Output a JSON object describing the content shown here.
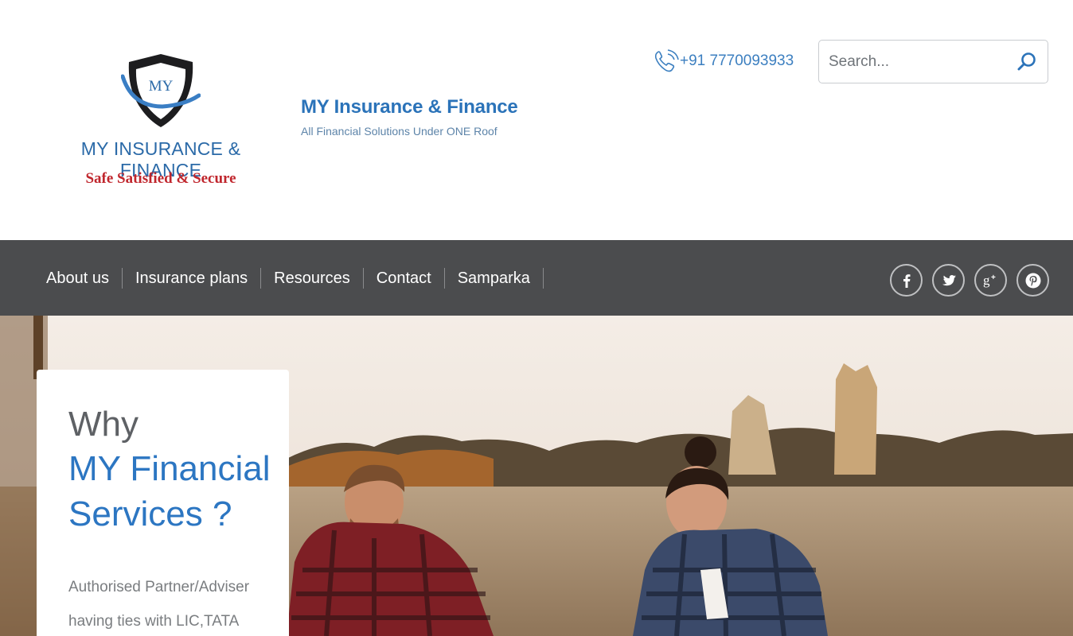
{
  "brand": {
    "logo_monogram": "MY",
    "logo_name": "MY INSURANCE & FINANCE",
    "logo_tagline": "Safe Satisfied & Secure",
    "site_title": "MY Insurance & Finance",
    "site_subtitle": "All Financial Solutions Under ONE Roof"
  },
  "contact": {
    "phone": "+91 7770093933",
    "icon": "phone-icon"
  },
  "search": {
    "placeholder": "Search...",
    "value": "",
    "icon": "search-icon"
  },
  "nav": {
    "items": [
      "About us",
      "Insurance plans",
      "Resources",
      "Contact",
      "Samparka"
    ]
  },
  "social": {
    "items": [
      "facebook-icon",
      "twitter-icon",
      "google-plus-icon",
      "pinterest-icon"
    ]
  },
  "hero": {
    "heading_line1": "Why",
    "heading_line2": "MY Financial",
    "heading_line3": "Services ?",
    "body": "Authorised Partner/Adviser having ties with LIC,TATA"
  },
  "colors": {
    "brand_blue": "#2b73b9",
    "tagline_red": "#c0262d",
    "nav_background": "#4b4c4e"
  }
}
